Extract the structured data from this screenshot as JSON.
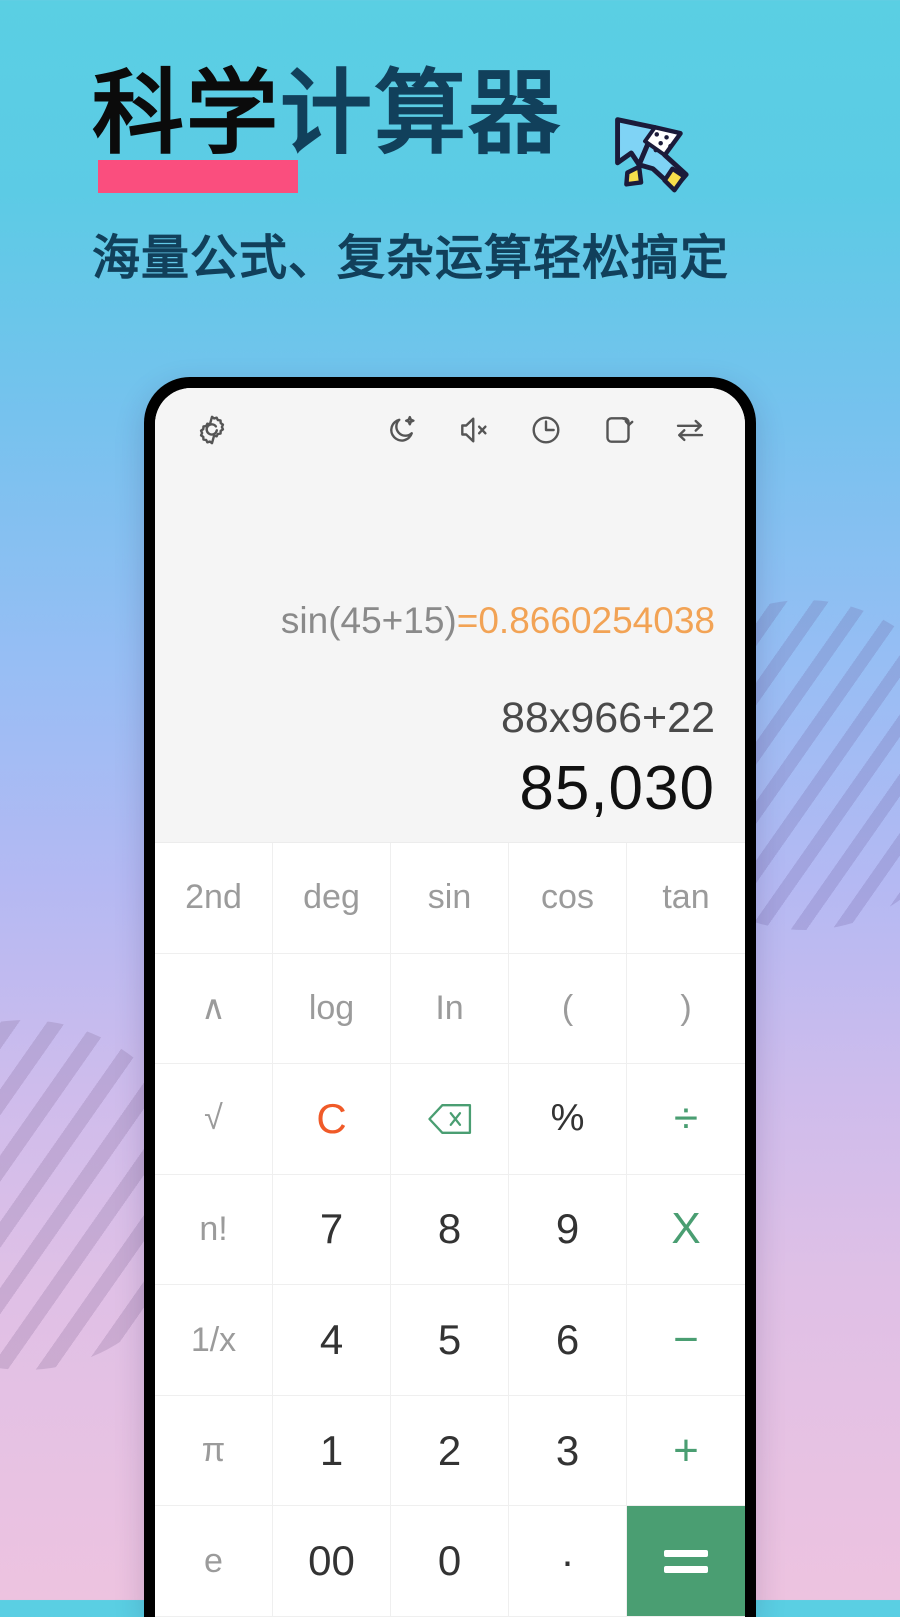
{
  "promo": {
    "title_part1": "科学",
    "title_part2": "计算器",
    "subtitle": "海量公式、复杂运算轻松搞定",
    "underline_color": "#FA4E7E",
    "title_dark_color": "#0B0B0B",
    "title_navy_color": "#11405B",
    "cursor_icon": "cursor-arrow-icon"
  },
  "background": {
    "top_color": "#5ACFE3",
    "mid_color": "#9CBDF2",
    "bottom_color": "#EDC3E0"
  },
  "app": {
    "toolbar": {
      "settings": "gear-icon",
      "theme": "moon-sparkle-icon",
      "sound": "speaker-mute-icon",
      "history": "clock-icon",
      "rotate": "rotate-screen-icon",
      "convert": "swap-arrows-icon"
    },
    "display": {
      "history_expression": "sin(45+15)",
      "history_equals": "=",
      "history_result": "0.8660254038",
      "current_expression": "88x966+22",
      "current_result": "85,030",
      "result_color": "#F2A355"
    },
    "keypad": {
      "equals_bg": "#4A9E72",
      "keys": [
        {
          "label": "2nd",
          "type": "fn"
        },
        {
          "label": "deg",
          "type": "fn"
        },
        {
          "label": "sin",
          "type": "fn"
        },
        {
          "label": "cos",
          "type": "fn"
        },
        {
          "label": "tan",
          "type": "fn"
        },
        {
          "label": "∧",
          "type": "fn"
        },
        {
          "label": "log",
          "type": "fn"
        },
        {
          "label": "In",
          "type": "fn"
        },
        {
          "label": "(",
          "type": "fn"
        },
        {
          "label": ")",
          "type": "fn"
        },
        {
          "label": "√",
          "type": "fn"
        },
        {
          "label": "C",
          "type": "clear"
        },
        {
          "label": "",
          "type": "backspace",
          "icon": "backspace-icon"
        },
        {
          "label": "%",
          "type": "pct"
        },
        {
          "label": "÷",
          "type": "op"
        },
        {
          "label": "n!",
          "type": "fn"
        },
        {
          "label": "7",
          "type": "num"
        },
        {
          "label": "8",
          "type": "num"
        },
        {
          "label": "9",
          "type": "num"
        },
        {
          "label": "X",
          "type": "op"
        },
        {
          "label": "1/x",
          "type": "fn"
        },
        {
          "label": "4",
          "type": "num"
        },
        {
          "label": "5",
          "type": "num"
        },
        {
          "label": "6",
          "type": "num"
        },
        {
          "label": "−",
          "type": "op"
        },
        {
          "label": "π",
          "type": "fn"
        },
        {
          "label": "1",
          "type": "num"
        },
        {
          "label": "2",
          "type": "num"
        },
        {
          "label": "3",
          "type": "num"
        },
        {
          "label": "+",
          "type": "op"
        },
        {
          "label": "e",
          "type": "fn"
        },
        {
          "label": "00",
          "type": "num"
        },
        {
          "label": "0",
          "type": "num"
        },
        {
          "label": "·",
          "type": "num"
        },
        {
          "label": "=",
          "type": "equals"
        }
      ]
    }
  }
}
